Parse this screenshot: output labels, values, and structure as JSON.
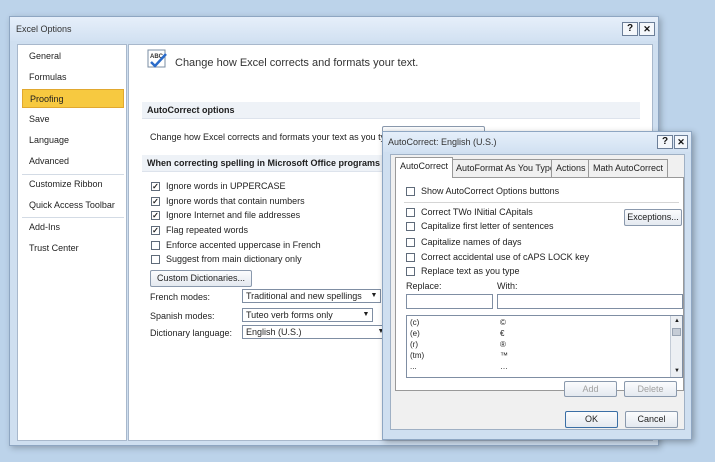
{
  "window": {
    "title": "Excel Options",
    "help_btn": "?",
    "close_btn": "✕"
  },
  "nav": {
    "items": [
      {
        "label": "General"
      },
      {
        "label": "Formulas"
      },
      {
        "label": "Proofing"
      },
      {
        "label": "Save"
      },
      {
        "label": "Language"
      },
      {
        "label": "Advanced"
      },
      {
        "label": "Customize Ribbon"
      },
      {
        "label": "Quick Access Toolbar"
      },
      {
        "label": "Add-Ins"
      },
      {
        "label": "Trust Center"
      }
    ],
    "selected": "Proofing"
  },
  "proofing": {
    "header_text": "Change how Excel corrects and formats your text.",
    "autocorrect_section": "AutoCorrect options",
    "autocorrect_label": "Change how Excel corrects and formats your text as you type:",
    "autocorrect_button": "AutoCorrect Options...",
    "spelling_section": "When correcting spelling in Microsoft Office programs",
    "options": [
      {
        "label": "Ignore words in UPPERCASE",
        "checked": true
      },
      {
        "label": "Ignore words that contain numbers",
        "checked": true
      },
      {
        "label": "Ignore Internet and file addresses",
        "checked": true
      },
      {
        "label": "Flag repeated words",
        "checked": true
      },
      {
        "label": "Enforce accented uppercase in French",
        "checked": false
      },
      {
        "label": "Suggest from main dictionary only",
        "checked": false
      }
    ],
    "custom_dict_button": "Custom Dictionaries...",
    "french_modes_label": "French modes:",
    "french_modes_value": "Traditional and new spellings",
    "spanish_modes_label": "Spanish modes:",
    "spanish_modes_value": "Tuteo verb forms only",
    "dictionary_language_label": "Dictionary language:",
    "dictionary_language_value": "English (U.S.)"
  },
  "autocorrect_dialog": {
    "title": "AutoCorrect: English (U.S.)",
    "help_btn": "?",
    "close_btn": "✕",
    "tabs": [
      {
        "label": "AutoCorrect"
      },
      {
        "label": "AutoFormat As You Type"
      },
      {
        "label": "Actions"
      },
      {
        "label": "Math AutoCorrect"
      }
    ],
    "active_tab": "AutoCorrect",
    "show_buttons": {
      "label": "Show AutoCorrect Options buttons",
      "checked": false
    },
    "options": [
      {
        "label": "Correct TWo INitial CApitals",
        "checked": false
      },
      {
        "label": "Capitalize first letter of sentences",
        "checked": false
      },
      {
        "label": "Capitalize names of days",
        "checked": false
      },
      {
        "label": "Correct accidental use of cAPS LOCK key",
        "checked": false
      },
      {
        "label": "Replace text as you type",
        "checked": false
      }
    ],
    "exceptions_button": "Exceptions...",
    "replace_label": "Replace:",
    "with_label": "With:",
    "list": [
      {
        "replace": "(c)",
        "with": "©"
      },
      {
        "replace": "(e)",
        "with": "€"
      },
      {
        "replace": "(r)",
        "with": "®"
      },
      {
        "replace": "(tm)",
        "with": "™"
      },
      {
        "replace": "...",
        "with": "…"
      }
    ],
    "add_button": "Add",
    "delete_button": "Delete",
    "ok_button": "OK",
    "cancel_button": "Cancel"
  }
}
